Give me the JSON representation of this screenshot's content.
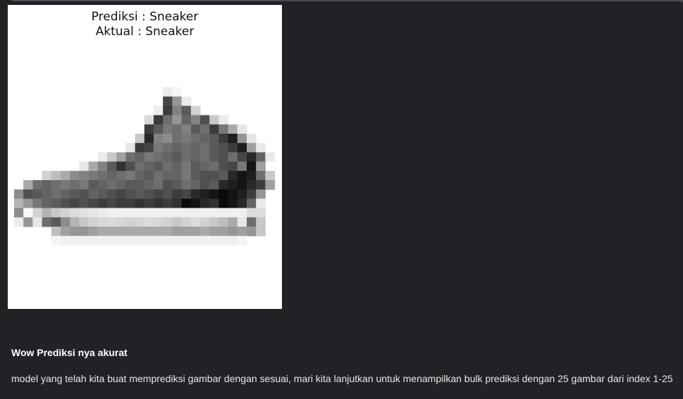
{
  "figure": {
    "title_prediction": "Prediksi : Sneaker",
    "title_actual": "Aktual : Sneaker",
    "image_description_icon": "sneaker-grayscale-image"
  },
  "markdown": {
    "heading": "Wow Prediksi nya akurat",
    "paragraph": "model yang telah kita buat memprediksi gambar dengan sesuai, mari kita lanjutkan untuk menampilkan bulk prediksi dengan 25 gambar dari index 1-25"
  },
  "colors": {
    "page_background": "#212226",
    "figure_background": "#ffffff",
    "text_light": "#ffffff"
  }
}
